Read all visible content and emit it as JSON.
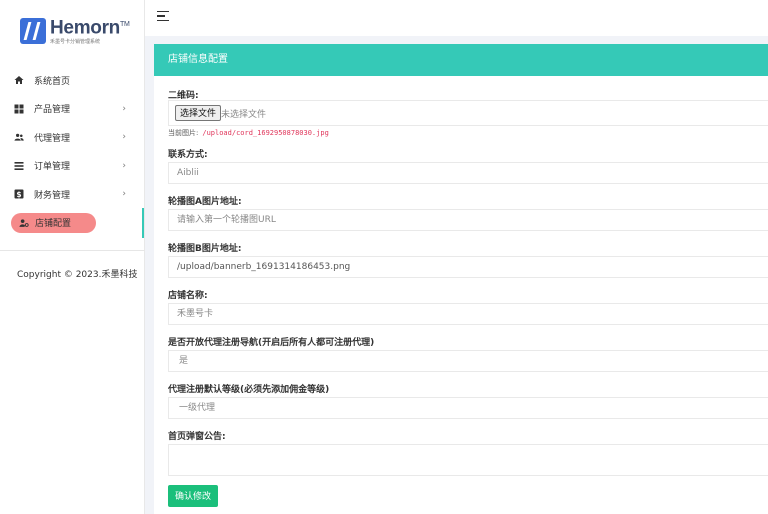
{
  "brand": {
    "title": "Hemorn",
    "tm": "TM",
    "subtitle": "禾墨号卡分销管理系统"
  },
  "sidebar": {
    "items": [
      {
        "label": "系统首页",
        "icon": "home-icon",
        "chevron": ""
      },
      {
        "label": "产品管理",
        "icon": "grid-icon",
        "chevron": "›"
      },
      {
        "label": "代理管理",
        "icon": "users-icon",
        "chevron": "›"
      },
      {
        "label": "订单管理",
        "icon": "list-icon",
        "chevron": "›"
      },
      {
        "label": "财务管理",
        "icon": "dollar-icon",
        "chevron": "›"
      },
      {
        "label": "店铺配置",
        "icon": "user-gear-icon",
        "chevron": ""
      }
    ],
    "active_index": 5,
    "copyright": "Copyright © 2023.禾墨科技"
  },
  "panel": {
    "title": "店铺信息配置"
  },
  "form": {
    "qrcode_label": "二维码:",
    "file_button": "选择文件",
    "file_status": "未选择文件",
    "current_label": "当前图片:",
    "current_path": "/upload/cord_1692950878030.jpg",
    "contact_label": "联系方式:",
    "contact_value": "Aiblii",
    "banner_a_label": "轮播图A图片地址:",
    "banner_a_placeholder": "请输入第一个轮播图URL",
    "banner_b_label": "轮播图B图片地址:",
    "banner_b_value": "/upload/bannerb_1691314186453.png",
    "shop_name_label": "店铺名称:",
    "shop_name_value": "禾墨号卡",
    "open_reg_label": "是否开放代理注册导航(开启后所有人都可注册代理)",
    "open_reg_value": "是",
    "default_level_label": "代理注册默认等级(必须先添加佣金等级)",
    "default_level_value": "一级代理",
    "notice_label": "首页弹窗公告:",
    "notice_value": "",
    "submit_label": "确认修改"
  },
  "colors": {
    "accent": "#35c9b7",
    "active_pill": "#f58a8a",
    "submit": "#1bbf7b"
  }
}
